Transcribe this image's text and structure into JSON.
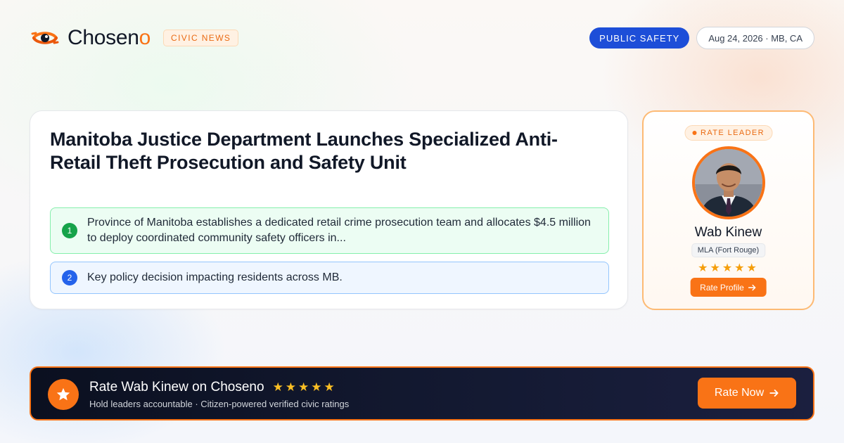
{
  "brand": {
    "name_main": "Chosen",
    "name_accent": "o",
    "tag": "CIVIC NEWS",
    "logo_icon": "eye-swirl-logo-icon",
    "accent_color": "#f97316"
  },
  "header": {
    "category": "PUBLIC SAFETY",
    "date_location": "Aug 24, 2026 · MB, CA"
  },
  "article": {
    "headline": "Manitoba Justice Department Launches Specialized Anti-Retail Theft Prosecution and Safety Unit",
    "points": [
      {
        "number": "1",
        "text": "Province of Manitoba establishes a dedicated retail crime prosecution team and allocates $4.5 million to deploy coordinated community safety officers in..."
      },
      {
        "number": "2",
        "text": "Key policy decision impacting residents across MB."
      }
    ]
  },
  "leader": {
    "tag": "RATE LEADER",
    "name": "Wab Kinew",
    "role": "MLA (Fort Rouge)",
    "stars": "★★★★★",
    "rate_button": "Rate Profile",
    "rate_button_icon": "arrow-right-icon"
  },
  "banner": {
    "title": "Rate Wab Kinew on Choseno",
    "stars": "★★★★★",
    "subtitle": "Hold leaders accountable · Citizen-powered verified civic ratings",
    "cta": "Rate Now",
    "cta_icon": "arrow-right-icon",
    "badge_icon": "star-icon"
  }
}
